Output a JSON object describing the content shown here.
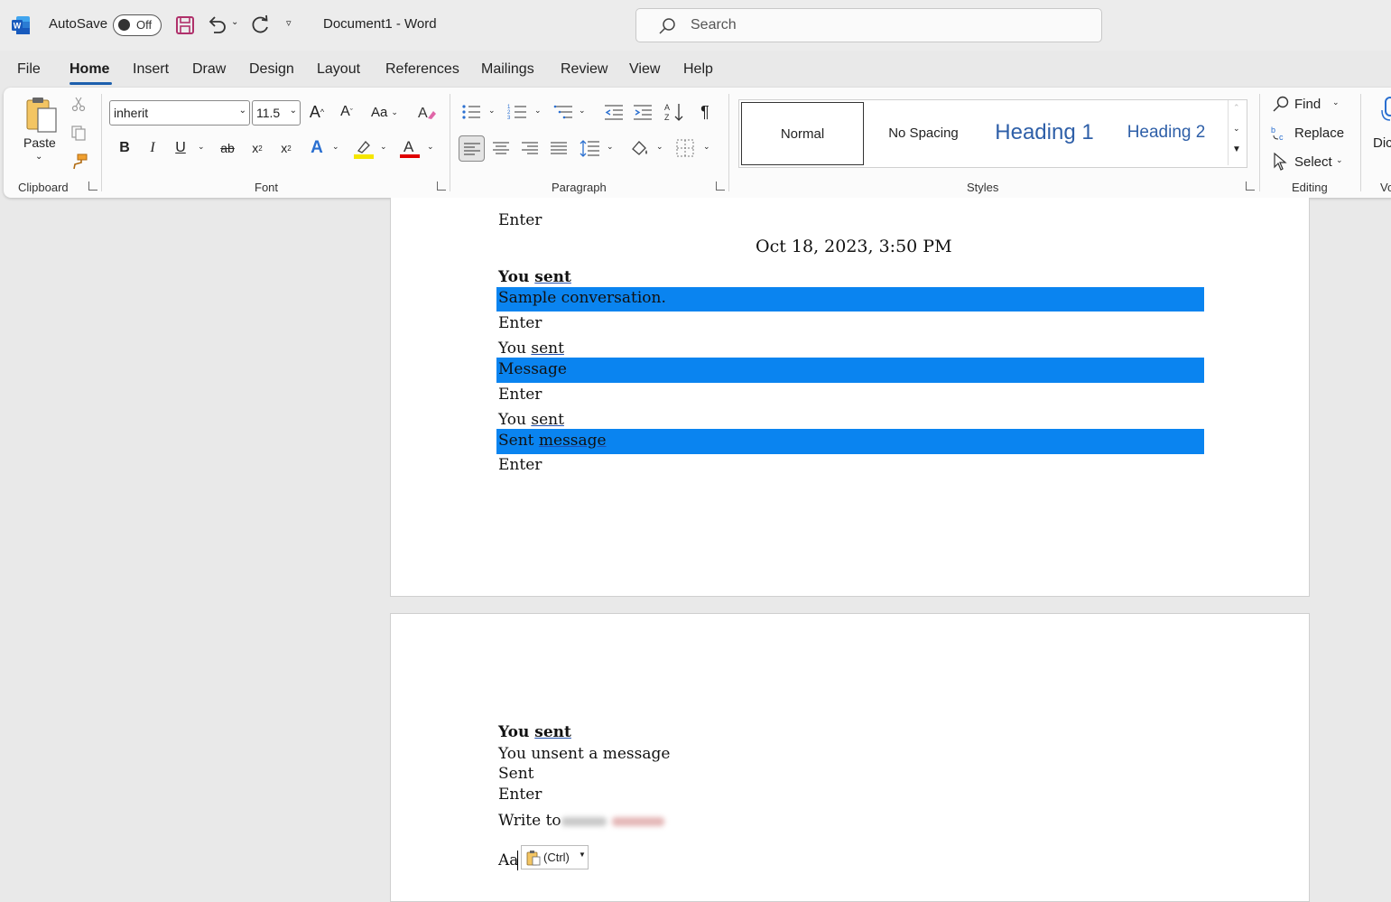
{
  "titlebar": {
    "autosave_label": "AutoSave",
    "autosave_state": "Off",
    "doc_title": "Document1  -  Word",
    "search_placeholder": "Search"
  },
  "menu": {
    "tabs": [
      "File",
      "Home",
      "Insert",
      "Draw",
      "Design",
      "Layout",
      "References",
      "Mailings",
      "Review",
      "View",
      "Help"
    ],
    "active": "Home"
  },
  "ribbon": {
    "clipboard": {
      "paste_label": "Paste",
      "group_label": "Clipboard"
    },
    "font": {
      "font_name": "inherit",
      "font_size": "11.5",
      "group_label": "Font",
      "case_label": "Aa",
      "highlight_color": "#f5e600",
      "font_color": "#e00000"
    },
    "paragraph": {
      "group_label": "Paragraph"
    },
    "styles": {
      "items": [
        "Normal",
        "No Spacing",
        "Heading 1",
        "Heading 2"
      ],
      "group_label": "Styles",
      "heading_color": "#2e5fa8"
    },
    "editing": {
      "find_label": "Find",
      "replace_label": "Replace",
      "select_label": "Select",
      "group_label": "Editing"
    },
    "voice": {
      "dictate_label": "Dic",
      "group_label": "Vo"
    }
  },
  "document": {
    "page1": {
      "line_enter_top": "Enter",
      "timestamp": "Oct 18, 2023, 3:50 PM",
      "you": "You",
      "sent": "sent",
      "msg1": "Sample conversation.",
      "enter1": "Enter",
      "msg2": "Message",
      "enter2": "Enter",
      "msg3_a": "Sent",
      "msg3_b": "message",
      "enter3": "Enter"
    },
    "page2": {
      "you": "You",
      "sent": "sent",
      "unsent": "You unsent a message",
      "sent_line": "Sent",
      "enter": "Enter",
      "write_to": "Write to",
      "cursor_text": "Aa",
      "paste_options": "(Ctrl)"
    },
    "highlight_color": "#0a84f0"
  }
}
